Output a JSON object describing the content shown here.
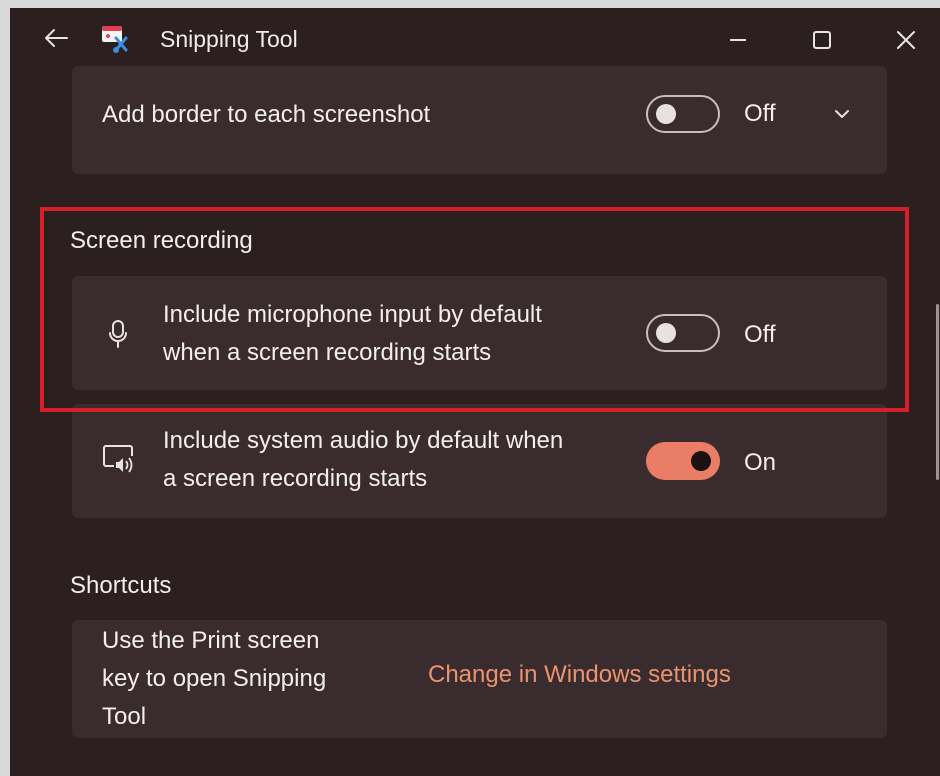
{
  "window": {
    "title": "Snipping Tool",
    "back_icon": "back-arrow-icon",
    "app_icon": "snipping-tool-icon",
    "controls": [
      "minimize-icon",
      "maximize-icon",
      "close-icon"
    ]
  },
  "settings": {
    "border": {
      "label": "Add border to each screenshot",
      "state": "Off",
      "expand_icon": "chevron-down-icon"
    },
    "screen_recording": {
      "title": "Screen recording",
      "microphone": {
        "icon": "microphone-icon",
        "line1": "Include microphone input by default",
        "line2": "when a screen recording starts",
        "state": "Off"
      },
      "system_audio": {
        "icon": "system-audio-icon",
        "line1": "Include system audio by default when",
        "line2": "a screen recording starts",
        "state": "On"
      }
    },
    "shortcuts": {
      "title": "Shortcuts",
      "line1": "Use the Print screen",
      "line2": "key to open Snipping",
      "line3": "Tool",
      "link": "Change in Windows settings"
    }
  },
  "colors": {
    "background": "#2b1f20",
    "card": "#3a2c2e",
    "accent": "#ea7d65",
    "highlight_border": "#d51f29",
    "link": "#e9936f"
  }
}
